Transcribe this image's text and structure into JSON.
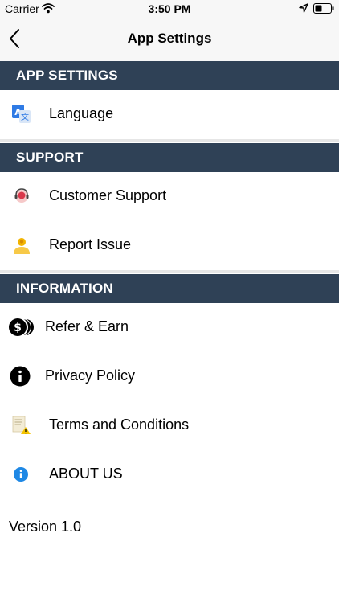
{
  "status_bar": {
    "carrier": "Carrier",
    "time": "3:50 PM",
    "icons": [
      "wifi-icon",
      "location-icon",
      "battery-icon"
    ]
  },
  "nav": {
    "title": "App Settings",
    "back_icon": "chevron-left-icon"
  },
  "sections": {
    "app_settings": {
      "title": "APP SETTINGS",
      "items": [
        {
          "label": "Language",
          "icon": "translate-icon"
        }
      ]
    },
    "support": {
      "title": "SUPPORT",
      "items": [
        {
          "label": "Customer Support",
          "icon": "customer-support-icon"
        },
        {
          "label": "Report Issue",
          "icon": "report-issue-icon"
        }
      ]
    },
    "information": {
      "title": "INFORMATION",
      "items": [
        {
          "label": "Refer & Earn",
          "icon": "coins-icon"
        },
        {
          "label": "Privacy Policy",
          "icon": "info-black-icon"
        },
        {
          "label": "Terms and Conditions",
          "icon": "document-warning-icon"
        },
        {
          "label": "ABOUT US",
          "icon": "info-blue-icon"
        }
      ]
    }
  },
  "version": "Version 1.0",
  "colors": {
    "section_header_bg": "#2f4156",
    "section_header_text": "#ffffff",
    "bar_bg": "#f7f7f7",
    "separator": "#e6e6e6",
    "info_blue": "#1e88e5"
  }
}
